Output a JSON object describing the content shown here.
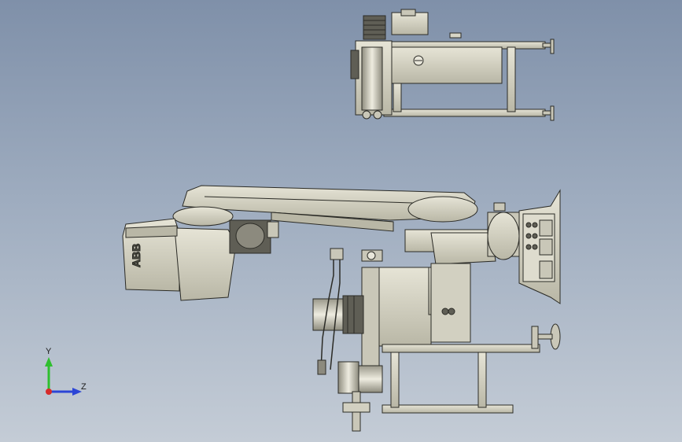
{
  "viewport": {
    "background_top": "#7f90a9",
    "background_bottom": "#c4ccd6",
    "part_fill": "#d7d5c6",
    "part_shadow": "#a9a796",
    "edge_color": "#2b2b26"
  },
  "robot": {
    "brand_logo": "ABB"
  },
  "triad": {
    "y_label": "Y",
    "z_label": "Z",
    "y_color": "#2fbf2f",
    "z_color": "#2b45d6",
    "x_color": "#d62b2b"
  }
}
